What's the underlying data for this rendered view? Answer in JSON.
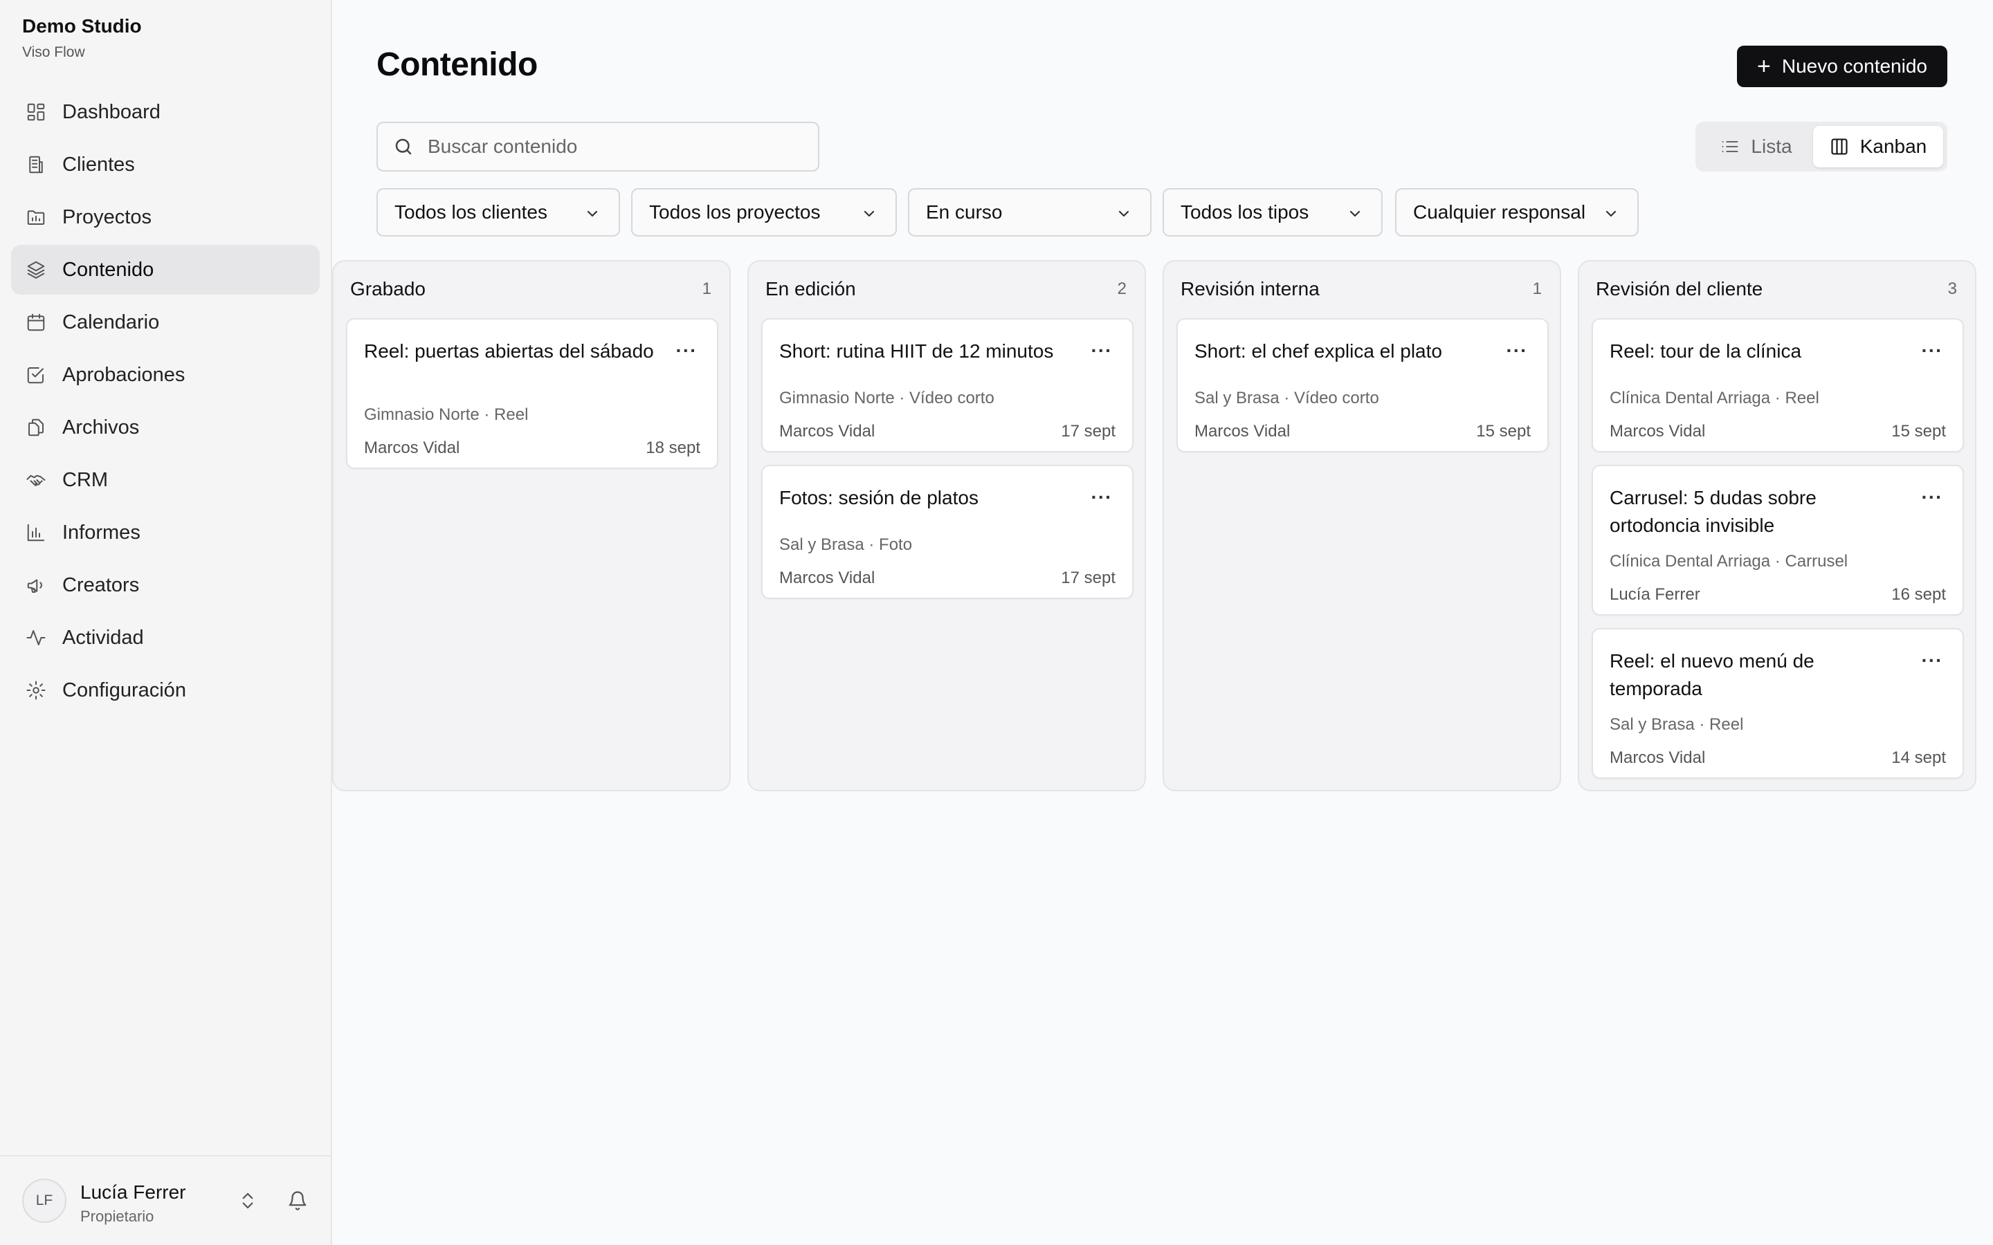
{
  "workspace": {
    "name": "Demo Studio",
    "product": "Viso Flow"
  },
  "sidebar": {
    "items": [
      {
        "label": "Dashboard",
        "icon": "dashboard-icon"
      },
      {
        "label": "Clientes",
        "icon": "building-icon"
      },
      {
        "label": "Proyectos",
        "icon": "folder-icon"
      },
      {
        "label": "Contenido",
        "icon": "layers-icon",
        "active": true
      },
      {
        "label": "Calendario",
        "icon": "calendar-icon"
      },
      {
        "label": "Aprobaciones",
        "icon": "check-square-icon"
      },
      {
        "label": "Archivos",
        "icon": "files-icon"
      },
      {
        "label": "CRM",
        "icon": "handshake-icon"
      },
      {
        "label": "Informes",
        "icon": "bar-chart-icon"
      },
      {
        "label": "Creators",
        "icon": "megaphone-icon"
      },
      {
        "label": "Actividad",
        "icon": "activity-icon"
      },
      {
        "label": "Configuración",
        "icon": "gear-icon"
      }
    ]
  },
  "user": {
    "initials": "LF",
    "name": "Lucía Ferrer",
    "role": "Propietario"
  },
  "header": {
    "title": "Contenido",
    "new_button_label": "Nuevo contenido"
  },
  "search": {
    "placeholder": "Buscar contenido",
    "value": ""
  },
  "view_toggle": {
    "list_label": "Lista",
    "kanban_label": "Kanban",
    "selected": "Kanban"
  },
  "filters": [
    {
      "label": "Todos los clientes"
    },
    {
      "label": "Todos los proyectos"
    },
    {
      "label": "En curso"
    },
    {
      "label": "Todos los tipos"
    },
    {
      "label": "Cualquier responsal"
    }
  ],
  "columns": [
    {
      "title": "Grabado",
      "count": "1",
      "cards": [
        {
          "title": "Reel: puertas abiertas del sábado",
          "meta": "Gimnasio Norte · Reel",
          "owner": "Marcos Vidal",
          "date": "18 sept"
        }
      ]
    },
    {
      "title": "En edición",
      "count": "2",
      "cards": [
        {
          "title": "Short: rutina HIIT de 12 minutos",
          "meta": "Gimnasio Norte · Vídeo corto",
          "owner": "Marcos Vidal",
          "date": "17 sept"
        },
        {
          "title": "Fotos: sesión de platos",
          "meta": "Sal y Brasa · Foto",
          "owner": "Marcos Vidal",
          "date": "17 sept"
        }
      ]
    },
    {
      "title": "Revisión interna",
      "count": "1",
      "cards": [
        {
          "title": "Short: el chef explica el plato",
          "meta": "Sal y Brasa · Vídeo corto",
          "owner": "Marcos Vidal",
          "date": "15 sept"
        }
      ]
    },
    {
      "title": "Revisión del cliente",
      "count": "3",
      "cards": [
        {
          "title": "Reel: tour de la clínica",
          "meta": "Clínica Dental Arriaga · Reel",
          "owner": "Marcos Vidal",
          "date": "15 sept"
        },
        {
          "title": "Carrusel: 5 dudas sobre ortodoncia invisible",
          "meta": "Clínica Dental Arriaga · Carrusel",
          "owner": "Lucía Ferrer",
          "date": "16 sept"
        },
        {
          "title": "Reel: el nuevo menú de temporada",
          "meta": "Sal y Brasa · Reel",
          "owner": "Marcos Vidal",
          "date": "14 sept"
        }
      ]
    }
  ]
}
